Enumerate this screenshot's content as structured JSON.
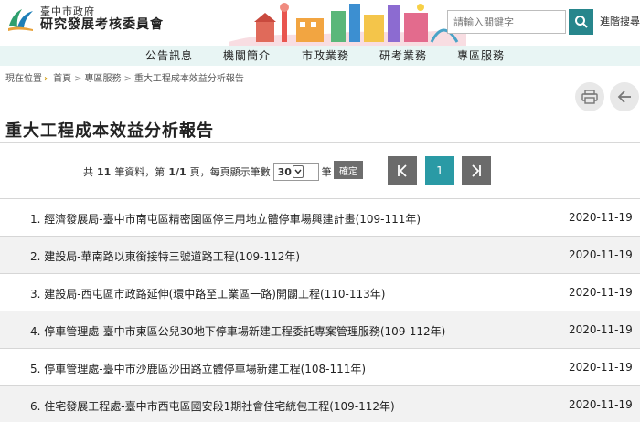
{
  "header": {
    "logo_line1": "臺中市政府",
    "logo_line2": "研究發展考核委員會",
    "search_placeholder": "請輸入關鍵字",
    "advanced_search": "進階搜尋"
  },
  "nav": {
    "items": [
      "公告訊息",
      "機關簡介",
      "市政業務",
      "研考業務",
      "專區服務"
    ]
  },
  "breadcrumb": {
    "prefix": "現在位置",
    "items": [
      "首頁",
      "專區服務",
      "重大工程成本效益分析報告"
    ]
  },
  "icons": {
    "print": "printer-icon",
    "back": "arrow-left-icon",
    "search": "search-icon"
  },
  "page": {
    "title": "重大工程成本效益分析報告"
  },
  "pager": {
    "total_prefix": "共",
    "total": "11",
    "total_suffix": "筆資料，第",
    "page_current": "1/1",
    "page_suffix": "頁，每頁顯示筆數",
    "per_page": "30",
    "per_page_suffix": "筆",
    "confirm": "確定",
    "current_page": "1"
  },
  "list": {
    "rows": [
      {
        "title": "1. 經濟發展局-臺中市南屯區精密園區停三用地立體停車場興建計畫(109-111年)",
        "date": "2020-11-19"
      },
      {
        "title": "2. 建設局-華南路以東銜接特三號道路工程(109-112年)",
        "date": "2020-11-19"
      },
      {
        "title": "3. 建設局-西屯區市政路延伸(環中路至工業區一路)開闢工程(110-113年)",
        "date": "2020-11-19"
      },
      {
        "title": "4. 停車管理處-臺中市東區公兒30地下停車場新建工程委託專案管理服務(109-112年)",
        "date": "2020-11-19"
      },
      {
        "title": "5. 停車管理處-臺中市沙鹿區沙田路立體停車場新建工程(108-111年)",
        "date": "2020-11-19"
      },
      {
        "title": "6. 住宅發展工程處-臺中市西屯區國安段1期社會住宅統包工程(109-112年)",
        "date": "2020-11-19"
      }
    ]
  },
  "colors": {
    "accent": "#2a9aa5",
    "nav_bg": "#e8f5f4",
    "pager_dark": "#6b6b6b"
  }
}
